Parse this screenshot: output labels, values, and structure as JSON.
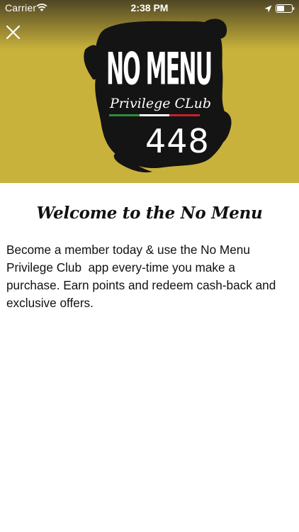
{
  "status_bar": {
    "carrier": "Carrier",
    "time": "2:38 PM"
  },
  "header": {
    "close_icon": "close-icon"
  },
  "hero": {
    "background_color": "#c8b13a",
    "logo": {
      "title": "NO MENU",
      "subtitle": "Privilege CLub",
      "number": "448",
      "flag_colors": [
        "#2e8b3d",
        "#ffffff",
        "#c8202a"
      ]
    }
  },
  "content": {
    "heading": "Welcome to the No Menu",
    "description": "Become a member today & use the No Menu Privilege Club  app every-time you make a purchase. Earn points and redeem cash-back and exclusive offers."
  }
}
